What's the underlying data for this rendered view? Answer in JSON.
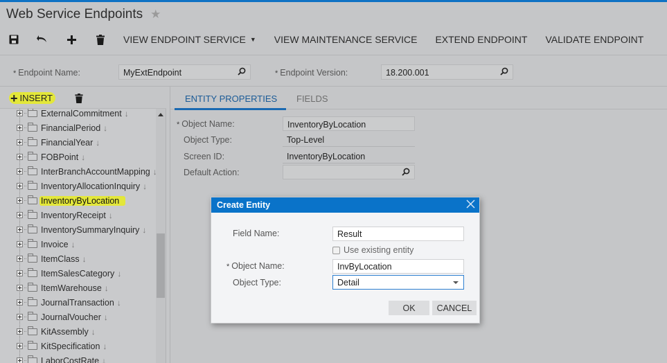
{
  "page": {
    "title": "Web Service Endpoints",
    "favorite_icon": "star-icon"
  },
  "toolbar": {
    "icons": [
      "save-icon",
      "undo-icon",
      "add-icon",
      "delete-icon"
    ],
    "buttons": [
      {
        "label": "VIEW ENDPOINT SERVICE",
        "has_dropdown": true
      },
      {
        "label": "VIEW MAINTENANCE SERVICE"
      },
      {
        "label": "EXTEND ENDPOINT"
      },
      {
        "label": "VALIDATE ENDPOINT"
      }
    ]
  },
  "form": {
    "endpoint_name_label": "Endpoint Name:",
    "endpoint_name_value": "MyExtEndpoint",
    "endpoint_version_label": "Endpoint Version:",
    "endpoint_version_value": "18.200.001",
    "required_marker": "*"
  },
  "tree": {
    "insert_label": "INSERT",
    "items": [
      {
        "name": "ExternalCommitment",
        "arrow": "↓"
      },
      {
        "name": "FinancialPeriod",
        "arrow": "↓"
      },
      {
        "name": "FinancialYear",
        "arrow": "↓"
      },
      {
        "name": "FOBPoint",
        "arrow": "↓"
      },
      {
        "name": "InterBranchAccountMapping",
        "arrow": "↓"
      },
      {
        "name": "InventoryAllocationInquiry",
        "arrow": "↓"
      },
      {
        "name": "InventoryByLocation",
        "arrow": "",
        "selected": true
      },
      {
        "name": "InventoryReceipt",
        "arrow": "↓"
      },
      {
        "name": "InventorySummaryInquiry",
        "arrow": "↓"
      },
      {
        "name": "Invoice",
        "arrow": "↓"
      },
      {
        "name": "ItemClass",
        "arrow": "↓"
      },
      {
        "name": "ItemSalesCategory",
        "arrow": "↓"
      },
      {
        "name": "ItemWarehouse",
        "arrow": "↓"
      },
      {
        "name": "JournalTransaction",
        "arrow": "↓"
      },
      {
        "name": "JournalVoucher",
        "arrow": "↓"
      },
      {
        "name": "KitAssembly",
        "arrow": "↓"
      },
      {
        "name": "KitSpecification",
        "arrow": "↓"
      },
      {
        "name": "LaborCostRate",
        "arrow": "↓"
      }
    ]
  },
  "tabs": [
    {
      "label": "ENTITY PROPERTIES",
      "active": true
    },
    {
      "label": "FIELDS",
      "active": false
    }
  ],
  "entity_properties": {
    "object_name_label": "Object Name:",
    "object_name_value": "InventoryByLocation",
    "object_type_label": "Object Type:",
    "object_type_value": "Top-Level",
    "screen_id_label": "Screen ID:",
    "screen_id_value": "InventoryByLocation",
    "default_action_label": "Default Action:",
    "default_action_value": ""
  },
  "dialog": {
    "title": "Create Entity",
    "field_name_label": "Field Name:",
    "field_name_value": "Result",
    "use_existing_label": "Use existing entity",
    "use_existing_checked": false,
    "object_name_label": "Object Name:",
    "object_name_value": "InvByLocation",
    "object_type_label": "Object Type:",
    "object_type_value": "Detail",
    "ok_label": "OK",
    "cancel_label": "CANCEL"
  },
  "colors": {
    "accent": "#0a73c9",
    "highlight": "#e3e73a",
    "tab_active": "#1b5b97"
  }
}
